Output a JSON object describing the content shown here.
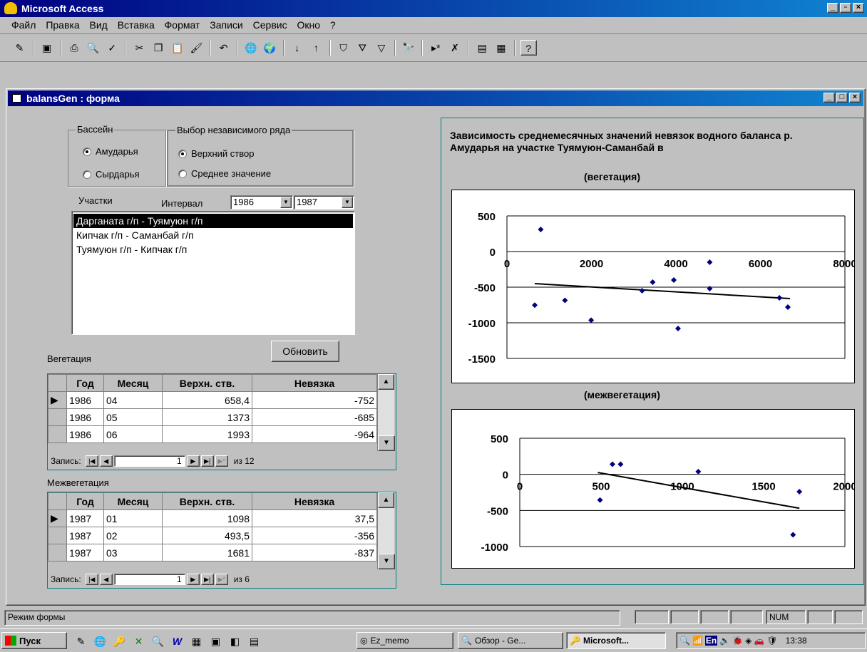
{
  "app": {
    "title": "Microsoft Access"
  },
  "menu": [
    "Файл",
    "Правка",
    "Вид",
    "Вставка",
    "Формат",
    "Записи",
    "Сервис",
    "Окно",
    "?"
  ],
  "form": {
    "title": "balansGen : форма"
  },
  "basin": {
    "legend": "Бассейн",
    "options": [
      "Амударья",
      "Сырдарья"
    ],
    "selected": 0
  },
  "series_choice": {
    "legend": "Выбор независимого ряда",
    "options": [
      "Верхний створ",
      "Среднее значение"
    ],
    "selected": 0
  },
  "sections": {
    "label": "Участки",
    "items": [
      "Дарганата г/п - Туямуюн г/п",
      "Кипчак г/п - Саманбай г/п",
      "Туямуюн г/п - Кипчак г/п"
    ],
    "selected": 0
  },
  "interval": {
    "label": "Интервал",
    "from": "1986",
    "to": "1987"
  },
  "refresh_label": "Обновить",
  "veg": {
    "label": "Вегетация",
    "headers": [
      "Год",
      "Месяц",
      "Верхн. ств.",
      "Невязка"
    ],
    "rows": [
      [
        "1986",
        "04",
        "658,4",
        "-752"
      ],
      [
        "1986",
        "05",
        "1373",
        "-685"
      ],
      [
        "1986",
        "06",
        "1993",
        "-964"
      ]
    ],
    "nav_label": "Запись:",
    "record": "1",
    "total": "из 12"
  },
  "mezh": {
    "label": "Межвегетация",
    "headers": [
      "Год",
      "Месяц",
      "Верхн. ств.",
      "Невязка"
    ],
    "rows": [
      [
        "1987",
        "01",
        "1098",
        "37,5"
      ],
      [
        "1987",
        "02",
        "493,5",
        "-356"
      ],
      [
        "1987",
        "03",
        "1681",
        "-837"
      ]
    ],
    "nav_label": "Запись:",
    "record": "1",
    "total": "из 6"
  },
  "chart_title": "Зависимость среднемесячных значений невязок водного баланса р. Амударья на участке Туямуюн-Саманбай в",
  "chart_data": [
    {
      "type": "scatter",
      "title": "(вегетация)",
      "xlim": [
        0,
        8000
      ],
      "ylim": [
        -1500,
        500
      ],
      "xticks": [
        0,
        2000,
        4000,
        6000,
        8000
      ],
      "yticks": [
        500,
        0,
        -500,
        -1000,
        -1500
      ],
      "points": [
        [
          658,
          -752
        ],
        [
          800,
          310
        ],
        [
          1373,
          -685
        ],
        [
          1993,
          -964
        ],
        [
          3200,
          -550
        ],
        [
          3450,
          -430
        ],
        [
          3950,
          -400
        ],
        [
          4050,
          -1080
        ],
        [
          4800,
          -150
        ],
        [
          4800,
          -520
        ],
        [
          6450,
          -650
        ],
        [
          6650,
          -780
        ]
      ],
      "trend": [
        [
          658,
          -450
        ],
        [
          6700,
          -660
        ]
      ],
      "color": "#000080"
    },
    {
      "type": "scatter",
      "title": "(межвегетация)",
      "xlim": [
        0,
        2000
      ],
      "ylim": [
        -1000,
        500
      ],
      "xticks": [
        0,
        500,
        1000,
        1500,
        2000
      ],
      "yticks": [
        500,
        0,
        -500,
        -1000
      ],
      "points": [
        [
          493.5,
          -356
        ],
        [
          570,
          140
        ],
        [
          620,
          140
        ],
        [
          1098,
          37.5
        ],
        [
          1681,
          -837
        ],
        [
          1720,
          -240
        ]
      ],
      "trend": [
        [
          480,
          25
        ],
        [
          1720,
          -470
        ]
      ],
      "color": "#000080"
    }
  ],
  "status": {
    "mode": "Режим формы",
    "num": "NUM"
  },
  "taskbar": {
    "start": "Пуск",
    "tasks": [
      "Ez_memo",
      "Обзор - Ge...",
      "Microsoft..."
    ],
    "clock": "13:38"
  }
}
